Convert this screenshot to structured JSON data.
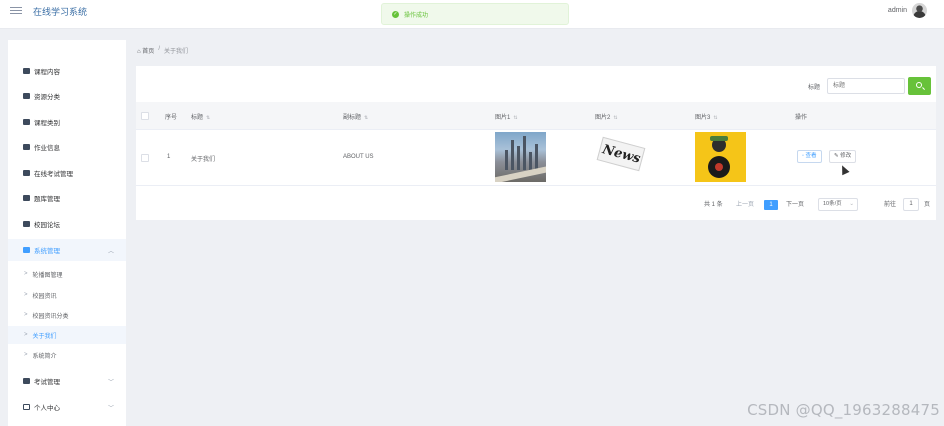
{
  "header": {
    "app_title": "在线学习系统",
    "toast": "操作成功",
    "user_name": "admin"
  },
  "sidebar": {
    "items": [
      {
        "label": "课程内容",
        "icon": "document-icon"
      },
      {
        "label": "资源分类",
        "icon": "folder-icon"
      },
      {
        "label": "课程类别",
        "icon": "grid-icon"
      },
      {
        "label": "作业信息",
        "icon": "grid-icon"
      },
      {
        "label": "在线考试管理",
        "icon": "grid-icon"
      },
      {
        "label": "题库管理",
        "icon": "image-icon"
      },
      {
        "label": "校园论坛",
        "icon": "grid-icon"
      },
      {
        "label": "系统管理",
        "icon": "briefcase-icon"
      }
    ],
    "sub_items": [
      {
        "label": "轮播图管理"
      },
      {
        "label": "校园资讯"
      },
      {
        "label": "校园资讯分类"
      },
      {
        "label": "关于我们"
      },
      {
        "label": "系统简介"
      }
    ],
    "bottom_items": [
      {
        "label": "考试管理",
        "icon": "monitor-icon"
      },
      {
        "label": "个人中心",
        "icon": "card-icon"
      }
    ]
  },
  "breadcrumb": {
    "home": "首页",
    "separator": "/",
    "current": "关于我们"
  },
  "search": {
    "label": "标题",
    "placeholder": "标题"
  },
  "table": {
    "headers": [
      "序号",
      "标题",
      "副标题",
      "图片1",
      "图片2",
      "图片3",
      "操作"
    ],
    "rows": [
      {
        "index": "1",
        "title": "关于我们",
        "subtitle": "ABOUT US",
        "actions": [
          "查看",
          "修改"
        ]
      }
    ]
  },
  "pagination": {
    "total": "共 1 条",
    "prev": "上一页",
    "current": "1",
    "next": "下一页",
    "page_size": "10条/页",
    "goto_label": "前往",
    "goto_value": "1",
    "goto_suffix": "页"
  },
  "watermark": "CSDN @QQ_1963288475",
  "colors": {
    "primary": "#409eff",
    "success": "#67c23a",
    "sidebar_bg": "#ffffff",
    "page_bg": "#eef0f4"
  }
}
